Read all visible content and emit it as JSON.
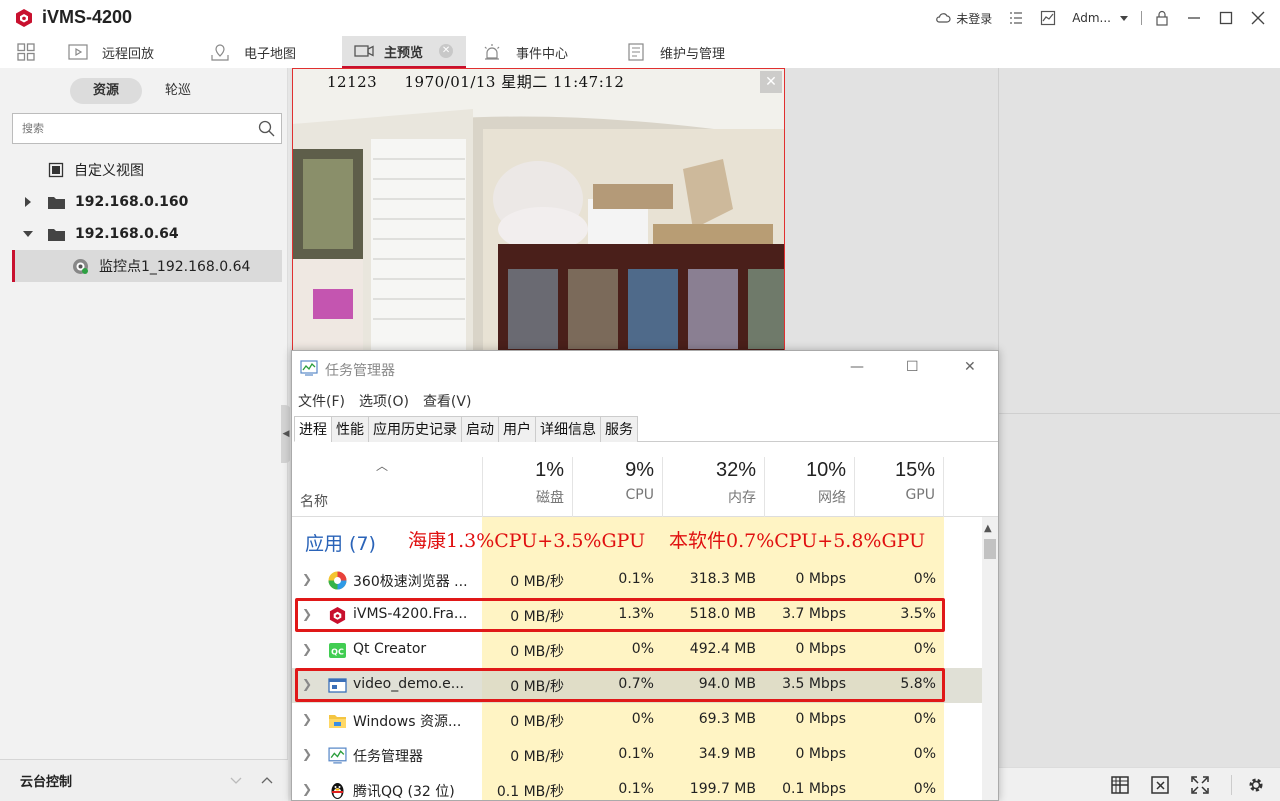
{
  "app": {
    "title": "iVMS-4200"
  },
  "titlebar": {
    "login_status": "未登录",
    "user": "Adm..."
  },
  "tabs": [
    {
      "label": "远程回放",
      "icon": "playback-icon"
    },
    {
      "label": "电子地图",
      "icon": "map-icon"
    },
    {
      "label": "主预览",
      "icon": "camera-icon",
      "active": true
    },
    {
      "label": "事件中心",
      "icon": "alarm-icon"
    },
    {
      "label": "维护与管理",
      "icon": "settings-doc-icon"
    }
  ],
  "left_panel": {
    "segment": [
      "资源",
      "轮巡"
    ],
    "search_placeholder": "搜索",
    "tree": [
      {
        "label": "自定义视图",
        "type": "view"
      },
      {
        "label": "192.168.0.160",
        "type": "device",
        "expanded": false
      },
      {
        "label": "192.168.0.64",
        "type": "device",
        "expanded": true
      },
      {
        "label": "监控点1_192.168.0.64",
        "type": "camera",
        "selected": true
      }
    ],
    "ptz_label": "云台控制"
  },
  "video": {
    "osd_channel": "12123",
    "osd_datetime": "1970/01/13 星期二 11:47:12"
  },
  "task_manager": {
    "title": "任务管理器",
    "menu": [
      "文件(F)",
      "选项(O)",
      "查看(V)"
    ],
    "tabs": [
      "进程",
      "性能",
      "应用历史记录",
      "启动",
      "用户",
      "详细信息",
      "服务"
    ],
    "name_col": "名称",
    "columns": [
      {
        "pct": "1%",
        "label": "磁盘"
      },
      {
        "pct": "9%",
        "label": "CPU"
      },
      {
        "pct": "32%",
        "label": "内存"
      },
      {
        "pct": "10%",
        "label": "网络"
      },
      {
        "pct": "15%",
        "label": "GPU"
      }
    ],
    "group": "应用 (7)",
    "annotation_left": "海康1.3%CPU+3.5%GPU",
    "annotation_right": "本软件0.7%CPU+5.8%GPU",
    "rows": [
      {
        "name": "360极速浏览器 ...",
        "disk": "0 MB/秒",
        "cpu": "0.1%",
        "mem": "318.3 MB",
        "net": "0 Mbps",
        "gpu": "0%"
      },
      {
        "name": "iVMS-4200.Fra...",
        "disk": "0 MB/秒",
        "cpu": "1.3%",
        "mem": "518.0 MB",
        "net": "3.7 Mbps",
        "gpu": "3.5%"
      },
      {
        "name": "Qt Creator",
        "disk": "0 MB/秒",
        "cpu": "0%",
        "mem": "492.4 MB",
        "net": "0 Mbps",
        "gpu": "0%"
      },
      {
        "name": "video_demo.e...",
        "disk": "0 MB/秒",
        "cpu": "0.7%",
        "mem": "94.0 MB",
        "net": "3.5 Mbps",
        "gpu": "5.8%"
      },
      {
        "name": "Windows 资源...",
        "disk": "0 MB/秒",
        "cpu": "0%",
        "mem": "69.3 MB",
        "net": "0 Mbps",
        "gpu": "0%"
      },
      {
        "name": "任务管理器",
        "disk": "0 MB/秒",
        "cpu": "0.1%",
        "mem": "34.9 MB",
        "net": "0 Mbps",
        "gpu": "0%"
      },
      {
        "name": "腾讯QQ (32 位)",
        "disk": "0.1 MB/秒",
        "cpu": "0.1%",
        "mem": "199.7 MB",
        "net": "0.1 Mbps",
        "gpu": "0%"
      }
    ]
  },
  "colors": {
    "brand_red": "#c8102e",
    "highlight_red": "#e01818",
    "column_yellow": "#fff4c4",
    "link_blue": "#2a63b8"
  }
}
